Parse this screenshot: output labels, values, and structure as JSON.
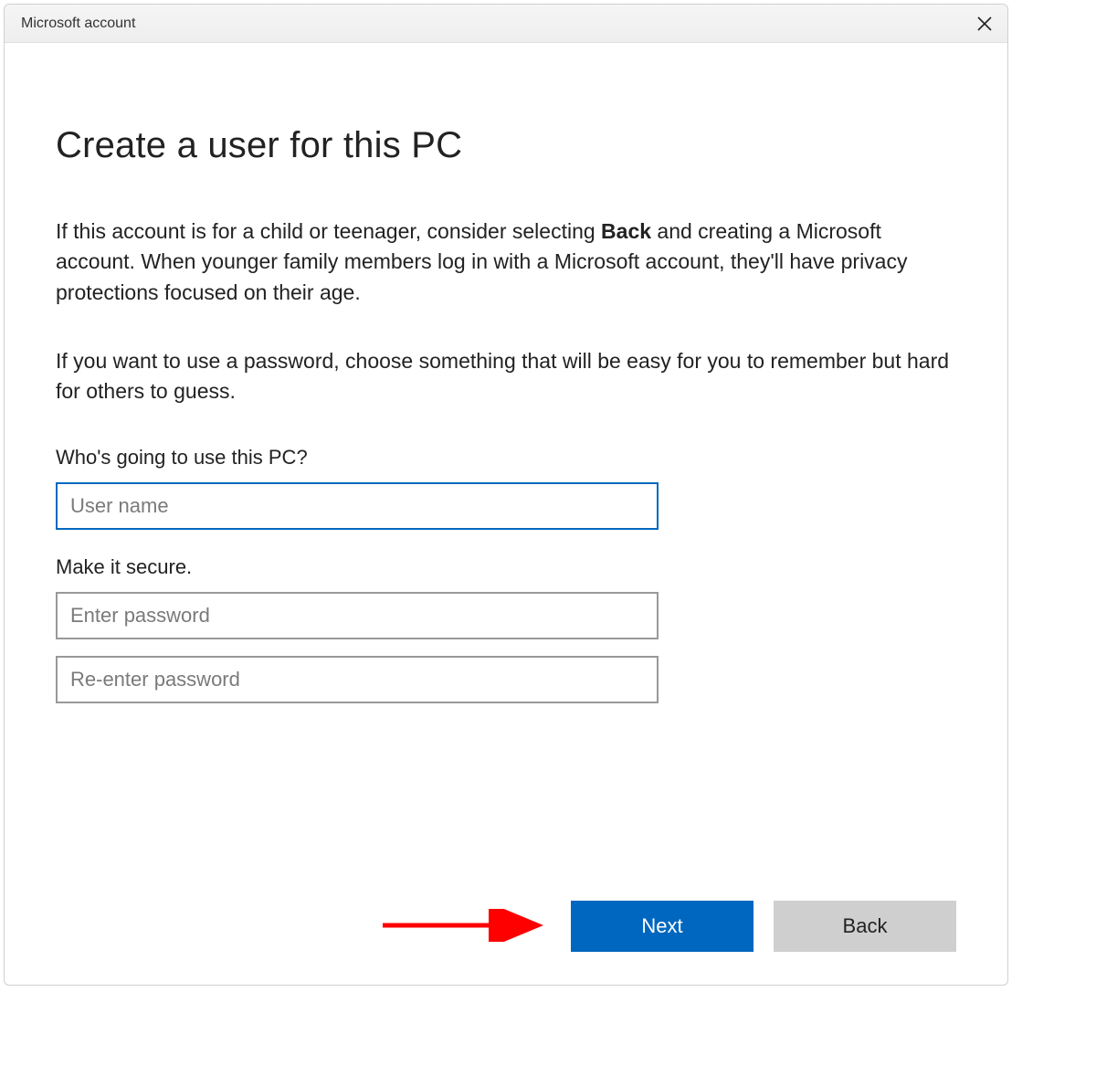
{
  "titlebar": {
    "title": "Microsoft account"
  },
  "page": {
    "heading": "Create a user for this PC",
    "desc1_pre": "If this account is for a child or teenager, consider selecting ",
    "desc1_bold": "Back",
    "desc1_post": " and creating a Microsoft account. When younger family members log in with a Microsoft account, they'll have privacy protections focused on their age.",
    "desc2": "If you want to use a password, choose something that will be easy for you to remember but hard for others to guess."
  },
  "form": {
    "who_label": "Who's going to use this PC?",
    "username_placeholder": "User name",
    "secure_label": "Make it secure.",
    "password_placeholder": "Enter password",
    "password2_placeholder": "Re-enter password"
  },
  "buttons": {
    "next": "Next",
    "back": "Back"
  },
  "colors": {
    "accent": "#0067c0",
    "annotation": "#ff0000"
  }
}
